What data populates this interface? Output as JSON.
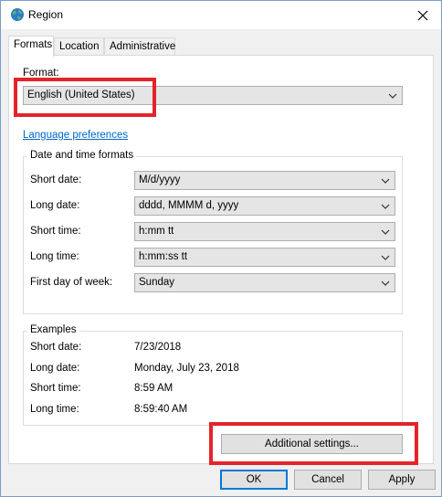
{
  "window": {
    "title": "Region"
  },
  "tabs": [
    {
      "label": "Formats"
    },
    {
      "label": "Location"
    },
    {
      "label": "Administrative"
    }
  ],
  "format": {
    "label": "Format:",
    "value": "English (United States)"
  },
  "language_link": "Language preferences",
  "datetime": {
    "group_title": "Date and time formats",
    "rows": [
      {
        "label": "Short date:",
        "value": "M/d/yyyy"
      },
      {
        "label": "Long date:",
        "value": "dddd, MMMM d, yyyy"
      },
      {
        "label": "Short time:",
        "value": "h:mm tt"
      },
      {
        "label": "Long time:",
        "value": "h:mm:ss tt"
      },
      {
        "label": "First day of week:",
        "value": "Sunday"
      }
    ]
  },
  "examples": {
    "group_title": "Examples",
    "rows": [
      {
        "label": "Short date:",
        "value": "7/23/2018"
      },
      {
        "label": "Long date:",
        "value": "Monday, July 23, 2018"
      },
      {
        "label": "Short time:",
        "value": "8:59 AM"
      },
      {
        "label": "Long time:",
        "value": "8:59:40 AM"
      }
    ]
  },
  "buttons": {
    "additional": "Additional settings...",
    "ok": "OK",
    "cancel": "Cancel",
    "apply": "Apply"
  },
  "colors": {
    "highlight": "#e3242b",
    "link": "#0066cc",
    "focus": "#0078d7"
  },
  "icons": {
    "title": "globe-icon",
    "close": "close-icon",
    "dropdown": "chevron-down-icon"
  }
}
